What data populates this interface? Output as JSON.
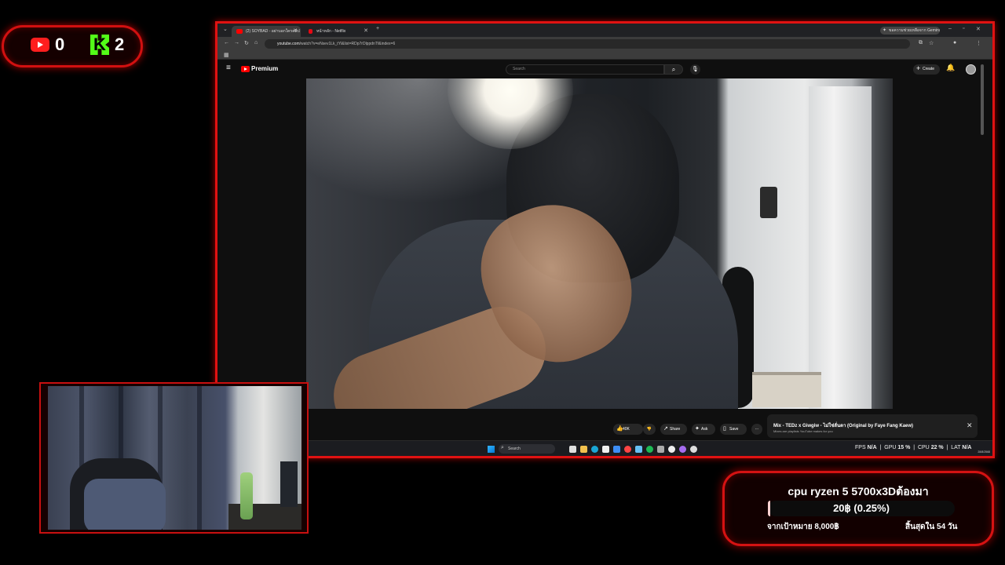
{
  "counter": {
    "youtube_count": "0",
    "kick_count": "2",
    "youtube_icon": "youtube-icon",
    "kick_icon": "kick-icon",
    "kick_letter": "K"
  },
  "browser": {
    "tabs": [
      {
        "label": "(2) SOYBAD - อย่าบอกใครคลิป"
      },
      {
        "label": "หน้าหลัก - Netflix"
      }
    ],
    "new_tab": "+",
    "gemini_label": "ขอความช่วยเหลือจาก Gemini",
    "window_controls": [
      "–",
      "▫",
      "✕"
    ],
    "url_host": "youtube.com",
    "url_path": "/watch?v=eNsev1Lk_tYl&list=RDp7rDlppdnTf&index=6",
    "nav_icons": [
      "←",
      "→",
      "↻",
      "⌂"
    ]
  },
  "youtube": {
    "brand": "Premium",
    "search_placeholder": "Search",
    "create_label": "Create",
    "actions": {
      "like_count": "40K",
      "share_label": "Share",
      "ask_label": "Ask",
      "save_label": "Save",
      "more_label": "···"
    },
    "miniplayer": {
      "title": "Mix - TEDz x Giwgiw - ไม่ใช่ลั่นตา (Original by Faye Fang Kaew)",
      "subtitle": "Mixes are playlists YouTube makes for you"
    }
  },
  "taskbar": {
    "search_label": "Search",
    "fps_label": "FPS",
    "fps_value": "N/A",
    "gpu_label": "GPU",
    "gpu_value": "15 %",
    "cpu_label": "CPU",
    "cpu_value": "22 %",
    "lat_label": "LAT",
    "lat_value": "N/A",
    "date": "28/8/2568"
  },
  "donation": {
    "title": "cpu ryzen 5 5700x3Dต้องมา",
    "amount": "20฿ (0.25%)",
    "progress_fraction": 0.0025,
    "goal": "จากเป้าหมาย 8,000฿",
    "ends": "สิ้นสุดใน 54 วัน"
  },
  "colors": {
    "accent": "#e01212",
    "kick_green": "#53fc18",
    "youtube_red": "#ff0000"
  }
}
